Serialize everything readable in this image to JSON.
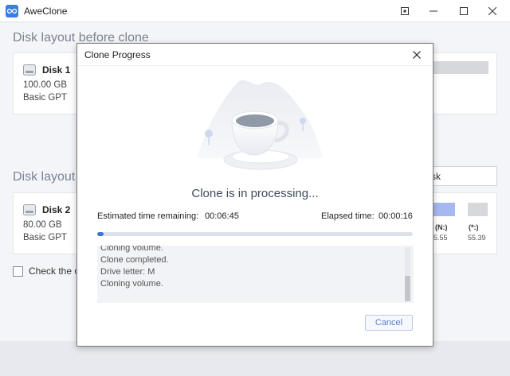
{
  "app": {
    "title": "AweClone"
  },
  "main": {
    "before_title": "Disk layout before clone",
    "after_title": "Disk layout a",
    "disk1": {
      "name": "Disk 1",
      "size": "100.00 GB",
      "type": "Basic GPT"
    },
    "disk2": {
      "name": "Disk 2",
      "size": "80.00 GB",
      "type": "Basic GPT",
      "partitions": [
        {
          "label": "(N:)",
          "sub": "5.55"
        },
        {
          "label": "(*:)",
          "sub": "55.39"
        }
      ]
    },
    "search_value": "sk",
    "check_label": "Check the op"
  },
  "dialog": {
    "title": "Clone Progress",
    "status": "Clone is in processing...",
    "time_remaining_label": "Estimated time remaining:",
    "time_remaining": "00:06:45",
    "elapsed_label": "Elapsed time:",
    "elapsed": "00:00:16",
    "progress_fraction": 0.02,
    "log": [
      "Cloning volume.",
      "Clone completed.",
      "Drive letter: M",
      "Cloning volume."
    ],
    "cancel_label": "Cancel"
  },
  "colors": {
    "accent": "#3c75d8",
    "partition_blue": "#a6b8f0",
    "partition_gray": "#d6d8dc"
  }
}
